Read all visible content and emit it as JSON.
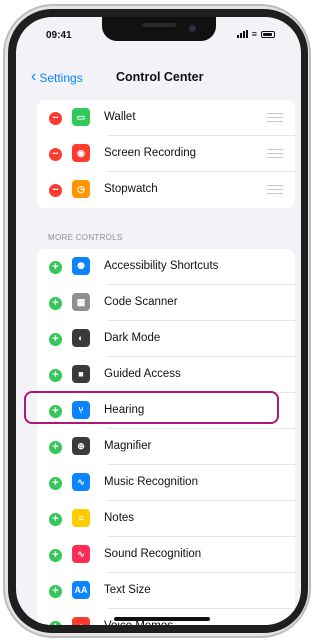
{
  "status_bar": {
    "time": "09:41",
    "wifi_glyph": "≡"
  },
  "nav": {
    "back_label": "Settings",
    "title": "Control Center"
  },
  "included_controls": [
    {
      "label": "Wallet",
      "icon": "wallet-icon",
      "icon_color": "#34c759",
      "icon_glyph": "▭"
    },
    {
      "label": "Screen Recording",
      "icon": "record-icon",
      "icon_color": "#ff3b30",
      "icon_glyph": "◉"
    },
    {
      "label": "Stopwatch",
      "icon": "stopwatch-icon",
      "icon_color": "#ff9500",
      "icon_glyph": "◷"
    }
  ],
  "more_controls_header": "MORE CONTROLS",
  "more_controls": [
    {
      "label": "Accessibility Shortcuts",
      "icon": "accessibility-icon",
      "icon_color": "#0a84ff",
      "icon_glyph": "⚉"
    },
    {
      "label": "Code Scanner",
      "icon": "qr-scanner-icon",
      "icon_color": "#8e8e93",
      "icon_glyph": "▦"
    },
    {
      "label": "Dark Mode",
      "icon": "dark-mode-icon",
      "icon_color": "#3a3a3c",
      "icon_glyph": "◐"
    },
    {
      "label": "Guided Access",
      "icon": "lock-icon",
      "icon_color": "#3a3a3c",
      "icon_glyph": "■"
    },
    {
      "label": "Hearing",
      "icon": "ear-icon",
      "icon_color": "#0a84ff",
      "icon_glyph": "⑂"
    },
    {
      "label": "Magnifier",
      "icon": "magnifier-icon",
      "icon_color": "#3a3a3c",
      "icon_glyph": "⊕"
    },
    {
      "label": "Music Recognition",
      "icon": "shazam-icon",
      "icon_color": "#0a84ff",
      "icon_glyph": "∿"
    },
    {
      "label": "Notes",
      "icon": "notes-icon",
      "icon_color": "#ffcc00",
      "icon_glyph": "≡"
    },
    {
      "label": "Sound Recognition",
      "icon": "sound-wave-icon",
      "icon_color": "#ff2d55",
      "icon_glyph": "∿"
    },
    {
      "label": "Text Size",
      "icon": "text-size-icon",
      "icon_color": "#0a84ff",
      "icon_glyph": "AA"
    },
    {
      "label": "Voice Memos",
      "icon": "voice-memo-icon",
      "icon_color": "#ff3b30",
      "icon_glyph": "●"
    }
  ],
  "highlighted_control": "Hearing",
  "colors": {
    "accent": "#0a84ff",
    "highlight_border": "#b0157a",
    "add": "#34c759",
    "remove": "#ff3b30"
  }
}
